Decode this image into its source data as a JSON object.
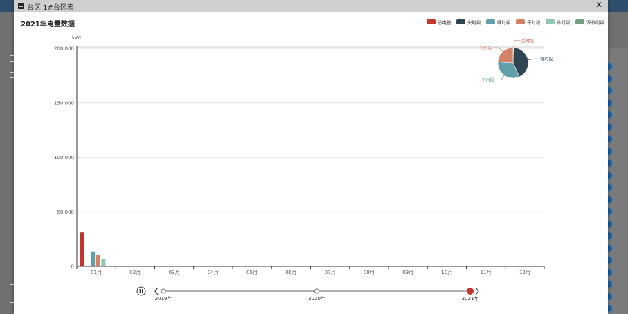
{
  "window": {
    "title": "台区 1#台区表"
  },
  "chart_data": {
    "type": "bar",
    "title": "2021年电量数据",
    "ylabel": "kWh",
    "ylim": [
      0,
      200000
    ],
    "yticks": [
      "0",
      "50,000",
      "100,000",
      "150,000",
      "200,000"
    ],
    "categories": [
      "01月",
      "02月",
      "03月",
      "04月",
      "05月",
      "06月",
      "07月",
      "08月",
      "09月",
      "10月",
      "11月",
      "12月"
    ],
    "legend_position": "top-right",
    "series": [
      {
        "name": "总电量",
        "color": "#c23531",
        "values": [
          31000,
          0,
          0,
          0,
          0,
          0,
          0,
          0,
          0,
          0,
          0,
          0
        ]
      },
      {
        "name": "尖时段",
        "color": "#2f4554",
        "values": [
          0,
          0,
          0,
          0,
          0,
          0,
          0,
          0,
          0,
          0,
          0,
          0
        ]
      },
      {
        "name": "峰时段",
        "color": "#61a0a8",
        "values": [
          13500,
          0,
          0,
          0,
          0,
          0,
          0,
          0,
          0,
          0,
          0,
          0
        ]
      },
      {
        "name": "平时段",
        "color": "#d48265",
        "values": [
          10500,
          0,
          0,
          0,
          0,
          0,
          0,
          0,
          0,
          0,
          0,
          0
        ]
      },
      {
        "name": "谷时段",
        "color": "#91c7ae",
        "values": [
          6500,
          0,
          0,
          0,
          0,
          0,
          0,
          0,
          0,
          0,
          0,
          0
        ]
      },
      {
        "name": "深谷时段",
        "color": "#749f83",
        "values": [
          0,
          0,
          0,
          0,
          0,
          0,
          0,
          0,
          0,
          0,
          0,
          0
        ]
      }
    ],
    "pie": {
      "slices": [
        {
          "name": "尖时段",
          "color": "#c23531",
          "value": 0.5
        },
        {
          "name": "峰时段",
          "color": "#2f4554",
          "value": 43
        },
        {
          "name": "平时段",
          "color": "#61a0a8",
          "value": 33
        },
        {
          "name": "谷时段",
          "color": "#d48265",
          "value": 24
        }
      ]
    },
    "timeline": {
      "labels": [
        "2019年",
        "2020年",
        "2021年"
      ],
      "current": 2
    }
  }
}
